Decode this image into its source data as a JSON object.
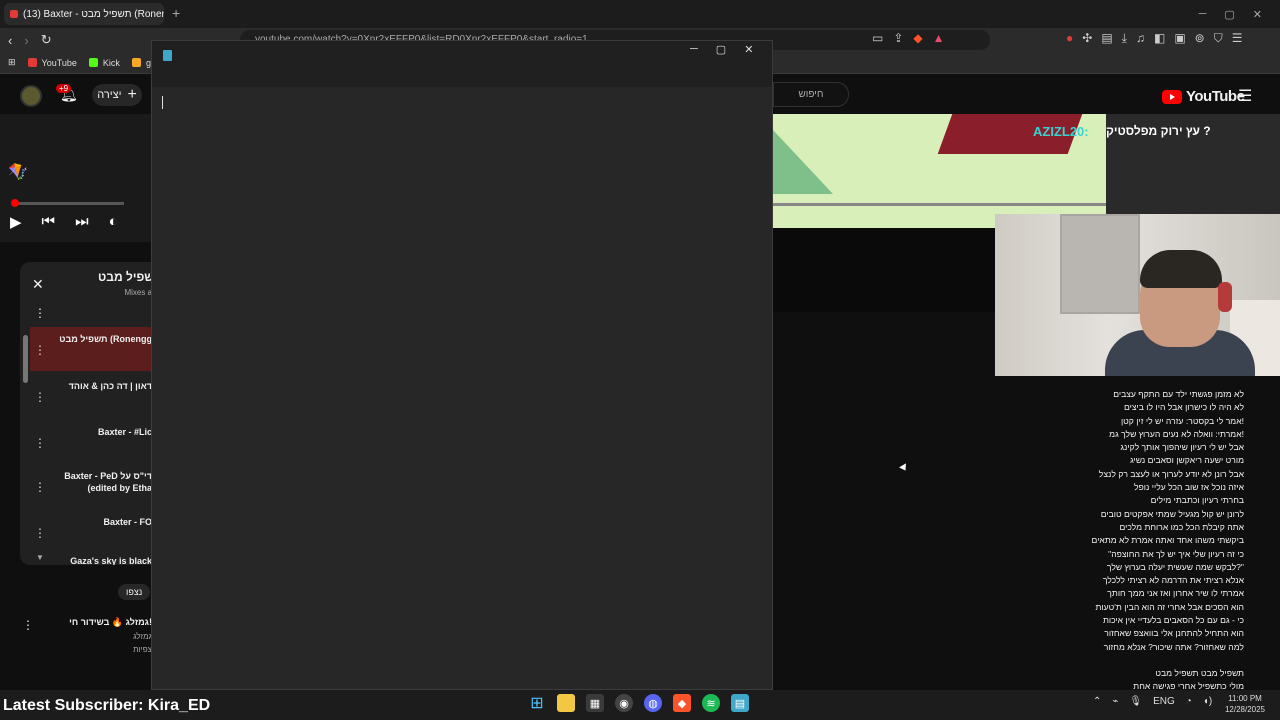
{
  "browser": {
    "tab_title": "(13) Baxter - תשפיל מבט (Ronen",
    "tab_close": "✕",
    "new_tab": "+",
    "url": "youtube.com/watch?v=0Xnr2xEFFP0&list=RD0Xnr2xEFFP0&start_radio=1",
    "bookmarks": [
      {
        "label": "YouTube",
        "color": "#e53935"
      },
      {
        "label": "Kick",
        "color": "#53fc18"
      },
      {
        "label": "g",
        "color": "#f9a825"
      }
    ]
  },
  "youtube_left": {
    "notif_count": "+9",
    "create_label": "יצירה",
    "playlist": {
      "title": "תשפיל מבט...",
      "subtitle": "Mixes a",
      "items": [
        {
          "text": "תשפיל מבט (Ronengg",
          "active": true
        },
        {
          "text": "דאון | דה כהן & אוהד",
          "active": false
        },
        {
          "text": "Baxter - #Lic",
          "active": false
        },
        {
          "text": "Baxter - PeD די\"ס על\n(edited by Etha",
          "active": false
        },
        {
          "text": "Baxter - FO",
          "active": false
        },
        {
          "text": "Gaza's sky is black",
          "active": false
        }
      ]
    },
    "now_label": "נצפו",
    "suggestion": {
      "title": "גמזלג 🔥 בשידור חי!",
      "channel": "גמזלג",
      "views": "צפיות"
    }
  },
  "notepad": {
    "title": ""
  },
  "youtube_right": {
    "logo_text": "YouTube",
    "search_placeholder": "חיפוש",
    "chat_user": "AZIZL20:",
    "chat_message": "עץ ירוק מפלסטיק ?",
    "lyrics_lines": [
      "לא מזמן פגשתי ילד עם התקף עצבים",
      "לא היה לו כישרון אבל היו לו ביצים",
      "אמר לי בקסטר: עזרה יש לי זין קטן!",
      "אמרתי: וואלה לא נעים הערוץ שלך גמ!",
      "אבל יש לי רעיון שיהפוך אותך לקינג",
      "מורט ישעה ריאקשן וסאבים נשיג",
      "אבל רונן לא יודע לערוך או לעצב רק לנצל",
      "איזה נוכל אז שוב הכל עליי נופל",
      "בחרתי רעיון וכתבתי מילים",
      "לרונן יש קול מגעיל שמתי אפקטים טובים",
      "אתה קיבלת הכל כמו ארוחת מלכים",
      "ביקשתי משהו אחד ואתה אמרת לא מתאים",
      "\"כי זה רעיון שלי איך יש לך את החוצפה",
      "לבקש שמה שעשית יעלה בערוץ שלך?\"",
      "אנלא רציתי את הדרמה לא רציתי ללכלך",
      "אמרתי לו שיר אחרון ואז אני ממך חותך",
      "הוא הסכים אבל אחרי זה הוא הבין ת'טעות",
      "כי - גם עם כל הסאבים בלעדיי אין איכות",
      "הוא התחיל להתחנן אלי בוואצפ שאחזור",
      "למה שאחזור? אתה שיכור? אנלא מחזור"
    ],
    "lyrics_title": "תשפיל מבט תשפיל מבט",
    "lyrics_next": "מולי כתשפיל אחרי פגישה אחת"
  },
  "taskbar": {
    "subscriber": "Latest Subscriber: Kira_ED",
    "lang": "ENG",
    "time": "11:00 PM",
    "date": "12/28/2025"
  }
}
